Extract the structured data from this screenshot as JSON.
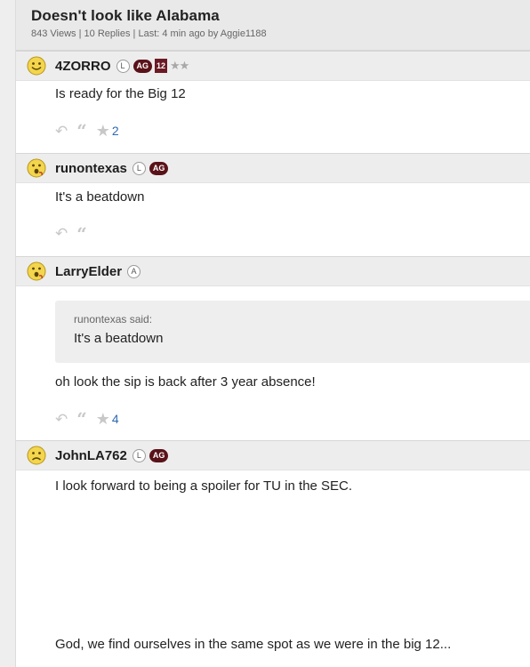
{
  "thread": {
    "title": "Doesn't look like Alabama",
    "meta": "843 Views | 10 Replies | Last: 4 min ago by Aggie1188"
  },
  "posts": [
    {
      "username": "4ZORRO",
      "badge_letter": "L",
      "badge_ag": "AG",
      "badge_conf": "12",
      "stars": "★★",
      "avatar_icon": "smiley-icon",
      "body": "Is ready for the Big 12",
      "star_count": "2"
    },
    {
      "username": "runontexas",
      "badge_letter": "L",
      "badge_ag": "AG",
      "avatar_icon": "surprised-icon",
      "body": "It's a beatdown"
    },
    {
      "username": "LarryElder",
      "badge_letter": "A",
      "avatar_icon": "surprised-icon",
      "quote_author": "runontexas said:",
      "quote_text": "It's a beatdown",
      "body": "oh look the sip is back after 3 year absence!",
      "star_count": "4"
    },
    {
      "username": "JohnLA762",
      "badge_letter": "L",
      "badge_ag": "AG",
      "avatar_icon": "frown-icon",
      "body": "I look forward to being a spoiler for TU in the SEC.",
      "body2": "God, we find ourselves in the same spot as we were in the big 12..."
    }
  ],
  "actions": {
    "reply_icon": "reply-icon",
    "quote_icon": "quote-icon",
    "star_icon": "star-icon"
  },
  "colors": {
    "maroon": "#5a1219",
    "link_blue": "#2e6bb0",
    "header_bg": "#e9e9e9",
    "action_gray": "#c8c8c8"
  }
}
